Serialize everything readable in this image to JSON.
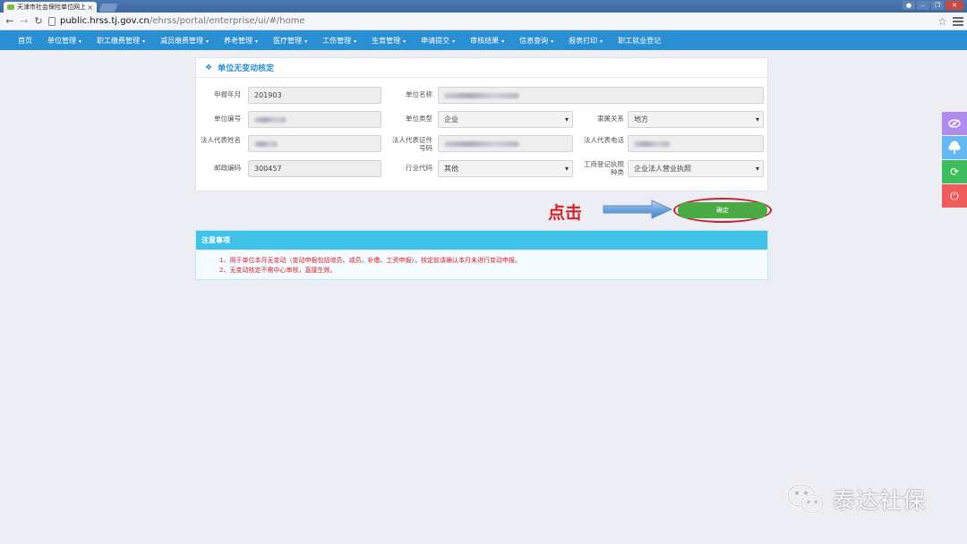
{
  "browser": {
    "tab_title": "天津市社会保险单位网上",
    "tab_close": "×",
    "url_host": "public.hrss.tj.gov.cn",
    "url_path": "/ehrss/portal/enterprise/ui/#/home"
  },
  "nav": {
    "items": [
      {
        "label": "首页",
        "dropdown": false
      },
      {
        "label": "单位管理",
        "dropdown": true
      },
      {
        "label": "职工缴费管理",
        "dropdown": true
      },
      {
        "label": "减员缴费管理",
        "dropdown": true
      },
      {
        "label": "养老管理",
        "dropdown": true
      },
      {
        "label": "医疗管理",
        "dropdown": true
      },
      {
        "label": "工伤管理",
        "dropdown": true
      },
      {
        "label": "生育管理",
        "dropdown": true
      },
      {
        "label": "申请提交",
        "dropdown": true
      },
      {
        "label": "审核结果",
        "dropdown": true
      },
      {
        "label": "信息查询",
        "dropdown": true
      },
      {
        "label": "报表打印",
        "dropdown": true
      },
      {
        "label": "职工就业登记",
        "dropdown": false
      }
    ],
    "caret": "▾"
  },
  "form": {
    "title": "单位无变动核定",
    "declare_month_label": "申报年月",
    "declare_month_value": "201903",
    "unit_name_label": "单位名称",
    "unit_code_label": "单位编号",
    "unit_type_label": "单位类型",
    "unit_type_value": "企业",
    "affiliation_label": "隶属关系",
    "affiliation_value": "地方",
    "legal_rep_name_label": "法人代表姓名",
    "legal_rep_id_label": "法人代表证件号码",
    "legal_rep_phone_label": "法人代表电话",
    "postcode_label": "邮政编码",
    "postcode_value": "300457",
    "industry_label": "行业代码",
    "industry_value": "其他",
    "license_type_label": "工商登记执照种类",
    "license_type_value": "企业法人营业执照"
  },
  "annotation": {
    "click_text": "点击"
  },
  "confirm_label": "确定",
  "notes": {
    "title": "注意事项",
    "lines": [
      "1、用于单位本月无变动（变动申报包括增员、减员、补缴、工资申报），核定前请确认本月未进行变动申报。",
      "2、无变动核定不需中心审核，直接生效。"
    ]
  },
  "side_tools": [
    {
      "icon": "eye-off-icon",
      "color": "#b18cf0"
    },
    {
      "icon": "tree-icon",
      "color": "#66b8f2"
    },
    {
      "icon": "refresh-icon",
      "color": "#3dbd5c"
    },
    {
      "icon": "power-icon",
      "color": "#ef5a5a"
    }
  ],
  "watermark": {
    "text": "泰达社保"
  },
  "colors": {
    "nav_bg": "#2a8fd2",
    "confirm_green": "#4aab44",
    "notes_header": "#3fc3e8",
    "alert_red": "#d6222a"
  }
}
